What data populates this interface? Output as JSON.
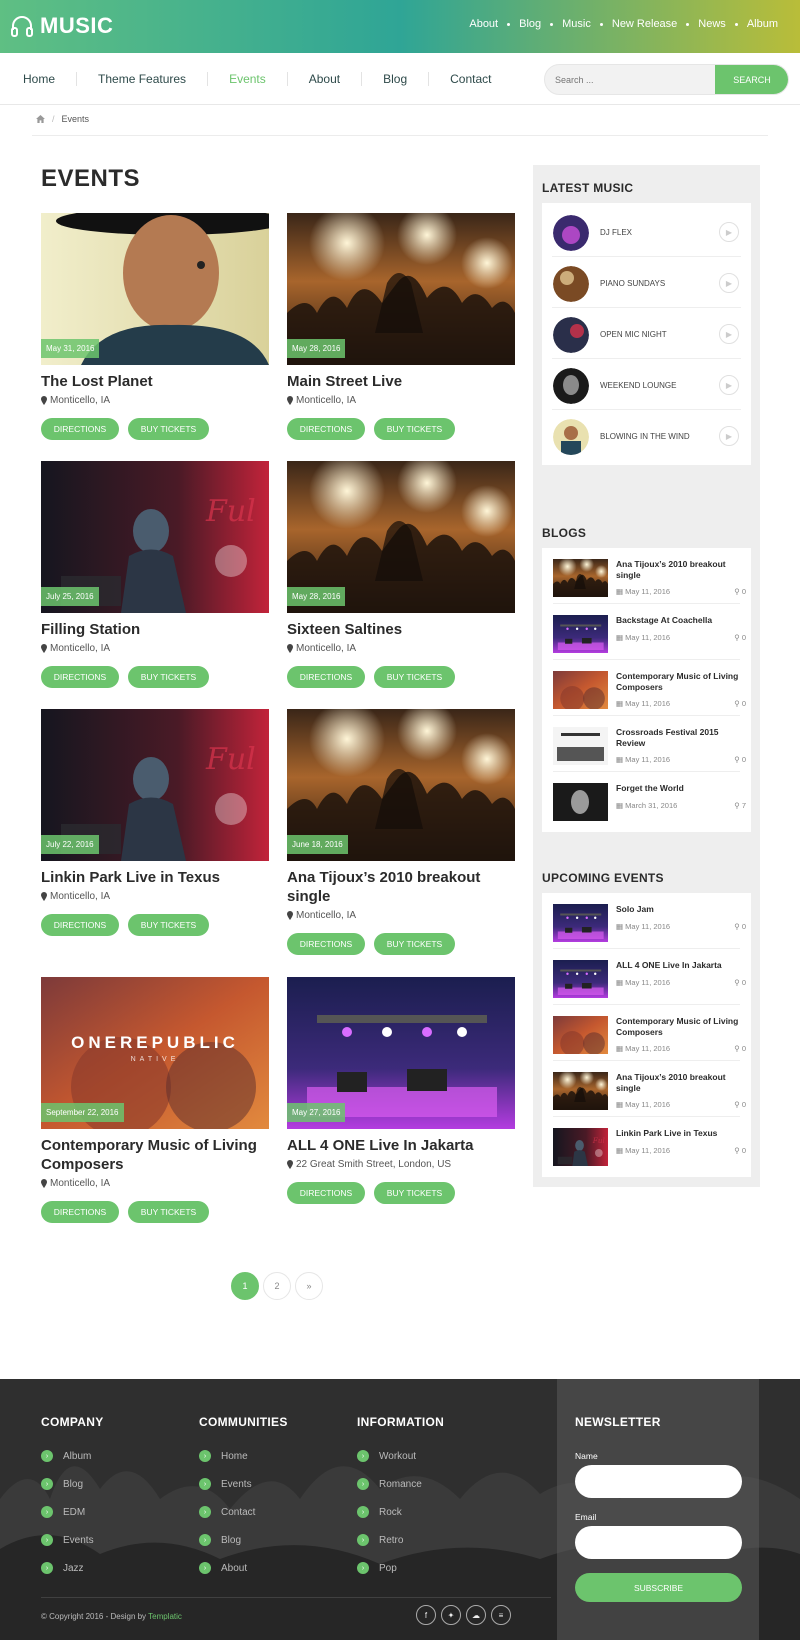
{
  "brand": {
    "name": "MUSIC"
  },
  "topnav": [
    "About",
    "Blog",
    "Music",
    "New Release",
    "News",
    "Album"
  ],
  "mainnav": {
    "items": [
      "Home",
      "Theme Features",
      "Events",
      "About",
      "Blog",
      "Contact"
    ],
    "active": "Events",
    "search_placeholder": "Search ...",
    "search_button": "SEARCH"
  },
  "breadcrumb": {
    "current": "Events"
  },
  "page_title": "EVENTS",
  "events": [
    {
      "title": "The Lost Planet",
      "date": "May 31, 2016",
      "location": "Monticello, IA",
      "directions": "DIRECTIONS",
      "tickets": "BUY TICKETS"
    },
    {
      "title": "Main Street Live",
      "date": "May 28, 2016",
      "location": "Monticello, IA",
      "directions": "DIRECTIONS",
      "tickets": "BUY TICKETS"
    },
    {
      "title": "Filling Station",
      "date": "July 25, 2016",
      "location": "Monticello, IA",
      "directions": "DIRECTIONS",
      "tickets": "BUY TICKETS"
    },
    {
      "title": "Sixteen Saltines",
      "date": "May 28, 2016",
      "location": "Monticello, IA",
      "directions": "DIRECTIONS",
      "tickets": "BUY TICKETS"
    },
    {
      "title": "Linkin Park Live in Texus",
      "date": "July 22, 2016",
      "location": "Monticello, IA",
      "directions": "DIRECTIONS",
      "tickets": "BUY TICKETS"
    },
    {
      "title": "Ana Tijoux’s 2010 breakout single",
      "date": "June 18, 2016",
      "location": "Monticello, IA",
      "directions": "DIRECTIONS",
      "tickets": "BUY TICKETS"
    },
    {
      "title": "Contemporary Music of Living Composers",
      "date": "September 22, 2016",
      "location": "Monticello, IA",
      "directions": "DIRECTIONS",
      "tickets": "BUY TICKETS",
      "overlay_text": "ONEREPUBLIC",
      "overlay_sub": "NATIVE"
    },
    {
      "title": "ALL 4 ONE Live In Jakarta",
      "date": "May 27, 2016",
      "location": "22 Great Smith Street, London, US",
      "directions": "DIRECTIONS",
      "tickets": "BUY TICKETS"
    }
  ],
  "pagination": [
    "1",
    "2",
    "»"
  ],
  "sidebar": {
    "latest_music": {
      "heading": "LATEST MUSIC",
      "items": [
        "DJ FLEX",
        "PIANO SUNDAYS",
        "OPEN MIC NIGHT",
        "WEEKEND LOUNGE",
        "BLOWING IN THE WIND"
      ]
    },
    "blogs": {
      "heading": "BLOGS",
      "items": [
        {
          "title": "Ana Tijoux’s 2010 breakout single",
          "date": "May 11, 2016",
          "comments": "0"
        },
        {
          "title": "Backstage At Coachella",
          "date": "May 11, 2016",
          "comments": "0"
        },
        {
          "title": "Contemporary Music of Living Composers",
          "date": "May 11, 2016",
          "comments": "0"
        },
        {
          "title": "Crossroads Festival 2015 Review",
          "date": "May 11, 2016",
          "comments": "0"
        },
        {
          "title": "Forget the World",
          "date": "March 31, 2016",
          "comments": "7"
        }
      ]
    },
    "upcoming": {
      "heading": "UPCOMING EVENTS",
      "items": [
        {
          "title": "Solo Jam",
          "date": "May 11, 2016",
          "comments": "0"
        },
        {
          "title": "ALL 4 ONE Live In Jakarta",
          "date": "May 11, 2016",
          "comments": "0"
        },
        {
          "title": "Contemporary Music of Living Composers",
          "date": "May 11, 2016",
          "comments": "0"
        },
        {
          "title": "Ana Tijoux’s 2010 breakout single",
          "date": "May 11, 2016",
          "comments": "0"
        },
        {
          "title": "Linkin Park Live in Texus",
          "date": "May 11, 2016",
          "comments": "0"
        }
      ]
    }
  },
  "footer": {
    "company": {
      "heading": "COMPANY",
      "items": [
        "Album",
        "Blog",
        "EDM",
        "Events",
        "Jazz"
      ]
    },
    "communities": {
      "heading": "COMMUNITIES",
      "items": [
        "Home",
        "Events",
        "Contact",
        "Blog",
        "About"
      ]
    },
    "information": {
      "heading": "INFORMATION",
      "items": [
        "Workout",
        "Romance",
        "Rock",
        "Retro",
        "Pop"
      ]
    },
    "newsletter": {
      "heading": "NEWSLETTER",
      "name_label": "Name",
      "email_label": "Email",
      "button": "SUBSCRIBE"
    },
    "copyright": "© Copyright 2016 - Design by",
    "designer": "Templatic",
    "social": [
      "facebook-icon",
      "twitter-icon",
      "soundcloud-icon",
      "spotify-icon"
    ]
  },
  "colors": {
    "accent": "#6cc46d",
    "header_gradient": [
      "#5fbf83",
      "#2fa596",
      "#b9bd39"
    ],
    "footer_bg": "#2f2f2f"
  }
}
